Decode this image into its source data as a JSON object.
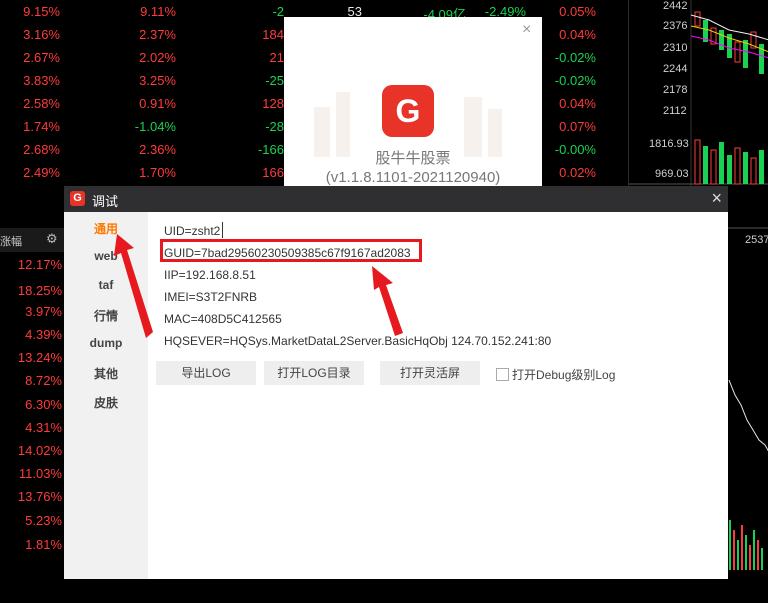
{
  "stock_rows": [
    {
      "c1": "9.15%",
      "c2": "9.11%",
      "c3": "-2",
      "c4": "53",
      "c5": "-4.09亿",
      "c6": "-2.49%",
      "c7": "0.05%"
    },
    {
      "c1": "3.16%",
      "c2": "2.37%",
      "c3": "184",
      "c4": "",
      "c5": "",
      "c6": "",
      "c7": "0.04%"
    },
    {
      "c1": "2.67%",
      "c2": "2.02%",
      "c3": "21",
      "c4": "",
      "c5": "",
      "c6": "",
      "c7": "-0.02%"
    },
    {
      "c1": "3.83%",
      "c2": "3.25%",
      "c3": "-25",
      "c4": "",
      "c5": "",
      "c6": "",
      "c7": "-0.02%"
    },
    {
      "c1": "2.58%",
      "c2": "0.91%",
      "c3": "128",
      "c4": "",
      "c5": "",
      "c6": "",
      "c7": "0.04%"
    },
    {
      "c1": "1.74%",
      "c2": "-1.04%",
      "c3": "-28",
      "c4": "",
      "c5": "",
      "c6": "",
      "c7": "0.07%"
    },
    {
      "c1": "2.68%",
      "c2": "2.36%",
      "c3": "-166",
      "c4": "",
      "c5": "",
      "c6": "",
      "c7": "-0.00%"
    },
    {
      "c1": "2.49%",
      "c2": "1.70%",
      "c3": "166",
      "c4": "",
      "c5": "",
      "c6": "",
      "c7": "0.02%"
    }
  ],
  "left_header": "涨幅",
  "left_values": [
    "12.17%",
    "18.25%",
    "3.97%",
    "4.39%",
    "13.24%",
    "8.72%",
    "6.30%",
    "4.31%",
    "14.02%",
    "11.03%",
    "13.76%",
    "5.23%",
    "1.81%"
  ],
  "chart_labels": [
    "2442",
    "2376",
    "2310",
    "2244",
    "2178",
    "2112",
    "1816.93",
    "969.03",
    "2537"
  ],
  "splash": {
    "close": "×",
    "app_name": "股牛牛股票",
    "version": "(v1.1.8.1101-2021120940)",
    "logo_letter": "G"
  },
  "dialog": {
    "icon_letter": "G",
    "title": "调试",
    "close": "×",
    "nav": [
      "通用",
      "web",
      "taf",
      "行情",
      "dump",
      "其他",
      "皮肤"
    ],
    "info": {
      "uid": "UID=zsht2",
      "guid": "GUID=7bad29560230509385c67f9167ad2083",
      "iip": "IIP=192.168.8.51",
      "imei": "IMEI=S3T2FNRB",
      "mac": "MAC=408D5C412565",
      "hqsever": "HQSEVER=HQSys.MarketDataL2Server.BasicHqObj 124.70.152.241:80"
    },
    "buttons": {
      "export_log": "导出LOG",
      "open_log_dir": "打开LOG目录",
      "open_flex_screen": "打开灵活屏"
    },
    "debug_checkbox_label": "打开Debug级别Log"
  },
  "colors": {
    "up": "#ff3b3b",
    "down": "#19d152",
    "accent": "#ff7a00",
    "annotation": "#e5191e"
  }
}
